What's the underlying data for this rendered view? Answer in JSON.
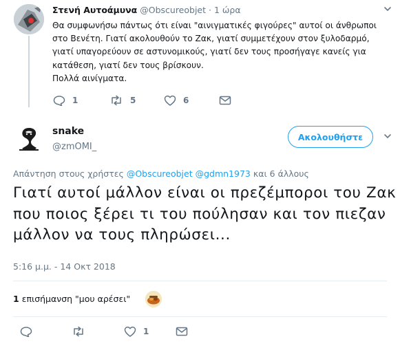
{
  "parent_tweet": {
    "name": "Στενή Αυτοάμυνα",
    "handle": "@Obscureobjet",
    "separator": "·",
    "time": "1 ώρα",
    "text_lines": [
      "Θα συμφωνήσω πάντως ότι είναι \"αινιγματικές φιγούρες\" αυτοί οι άνθρωποι στο Βενέτη. Γιατί ακολουθούν το Ζακ, γιατί συμμετέχουν στον ξυλοδαρμό, γιατί υπαγορεύουν σε αστυνομικούς, γιατί δεν τους προσήγαγε κανείς για κατάθεση, γιατί δεν τους βρίσκουν.",
      "Πολλά αινίγματα."
    ],
    "replies": "1",
    "retweets": "5",
    "likes": "6"
  },
  "main_tweet": {
    "name": "snake",
    "handle": "@zmOMI_",
    "follow_label": "Ακολουθήστε",
    "reply_prefix": "Απάντηση στους χρήστες",
    "reply_users": [
      "@Obscureobjet",
      "@gdmn1973"
    ],
    "reply_suffix": "και 6 άλλους",
    "text": "Γιατί αυτοί μάλλον είναι οι πρεζέμποροι του Ζακ που ποιος ξέρει τι του πούλησαν και τον πιεζαν μάλλον να τους πληρώσει...",
    "timestamp": "5:16 μ.μ. - 14 Οκτ 2018",
    "like_count": "1",
    "like_label": "επισήμανση \"μου αρέσει\"",
    "actions": {
      "replies": "",
      "retweets": "",
      "likes": "1"
    }
  },
  "colors": {
    "accent": "#1da1f2",
    "muted": "#657786",
    "divider": "#e6ecf0"
  },
  "icons": [
    "reply-icon",
    "retweet-icon",
    "heart-icon",
    "mail-icon",
    "chevron-down-icon"
  ]
}
